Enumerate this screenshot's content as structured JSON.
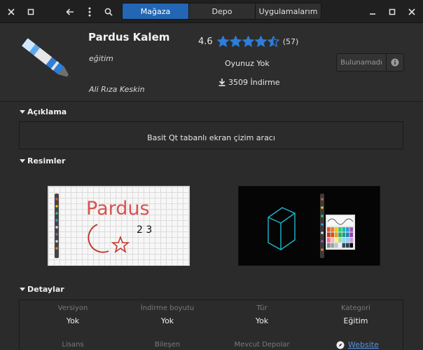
{
  "header": {
    "tabs": [
      "Mağaza",
      "Depo",
      "Uygulamalarım"
    ],
    "active_tab": 0,
    "icons": [
      "close-icon",
      "maximize-icon",
      "back-icon",
      "menu-icon",
      "search-icon"
    ],
    "right_icons": [
      "minimize-icon",
      "maximize-icon",
      "close-icon"
    ]
  },
  "app": {
    "name": "Pardus Kalem",
    "category": "eğitim",
    "author": "Ali Rıza Keskin",
    "rating_value": "4.6",
    "rating_stars": 4.5,
    "rating_count": "(57)",
    "game_status": "Oyunuz Yok",
    "downloads": "3509 İndirme",
    "install_label": "Bulunamadı",
    "accent": "#2366b3"
  },
  "sections": {
    "description_title": "Açıklama",
    "description_text": "Basit Qt tabanlı ekran çizim aracı",
    "screenshots_title": "Resimler",
    "details_title": "Detaylar"
  },
  "screenshot1": {
    "text_pardus": "Pardus",
    "text_numbers": "2 3"
  },
  "details": {
    "row1": [
      {
        "label": "Versiyon",
        "value": "Yok"
      },
      {
        "label": "İndirme boyutu",
        "value": "Yok"
      },
      {
        "label": "Tür",
        "value": "Yok"
      },
      {
        "label": "Kategori",
        "value": "Eğitim"
      }
    ],
    "row2": [
      "Lisans",
      "Bileşen",
      "Mevcut Depolar"
    ],
    "website": "Website"
  }
}
